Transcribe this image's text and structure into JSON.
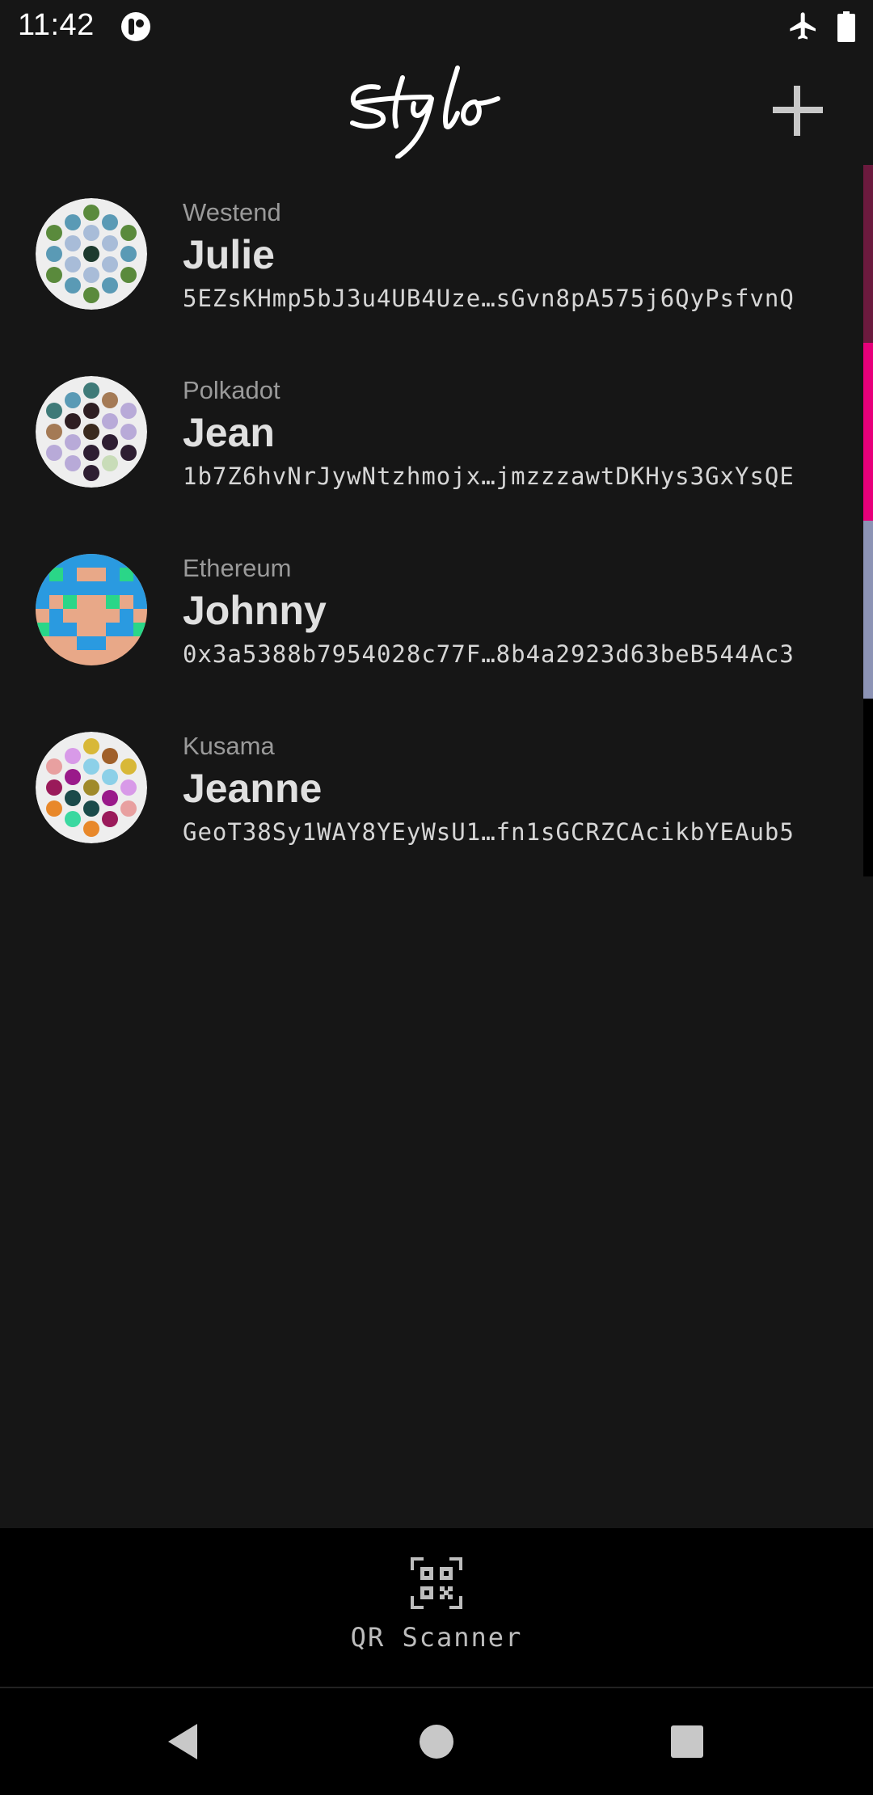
{
  "status_bar": {
    "time": "11:42"
  },
  "header": {
    "logo_text": "Stylo",
    "add_icon": "plus-icon"
  },
  "accounts": [
    {
      "network": "Westend",
      "name": "Julie",
      "address": "5EZsKHmp5bJ3u4UB4Uze…sGvn8pA575j6QyPsfvnQ",
      "network_color": "#6b1a3e"
    },
    {
      "network": "Polkadot",
      "name": "Jean",
      "address": "1b7Z6hvNrJywNtzhmojx…jmzzzawtDKHys3GxYsQE",
      "network_color": "#e6007a"
    },
    {
      "network": "Ethereum",
      "name": "Johnny",
      "address": "0x3a5388b7954028c77F…8b4a2923d63beB544Ac3",
      "network_color": "#8c93b5"
    },
    {
      "network": "Kusama",
      "name": "Jeanne",
      "address": "GeoT38Sy1WAY8YEyWsU1…fn1sGCRZCAcikbYEAub5",
      "network_color": "#000000"
    }
  ],
  "bottom_bar": {
    "qr_label": "QR Scanner",
    "qr_icon": "qr-code-icon"
  },
  "nav": {
    "back_icon": "back-triangle-icon",
    "home_icon": "home-circle-icon",
    "recents_icon": "recents-square-icon"
  }
}
